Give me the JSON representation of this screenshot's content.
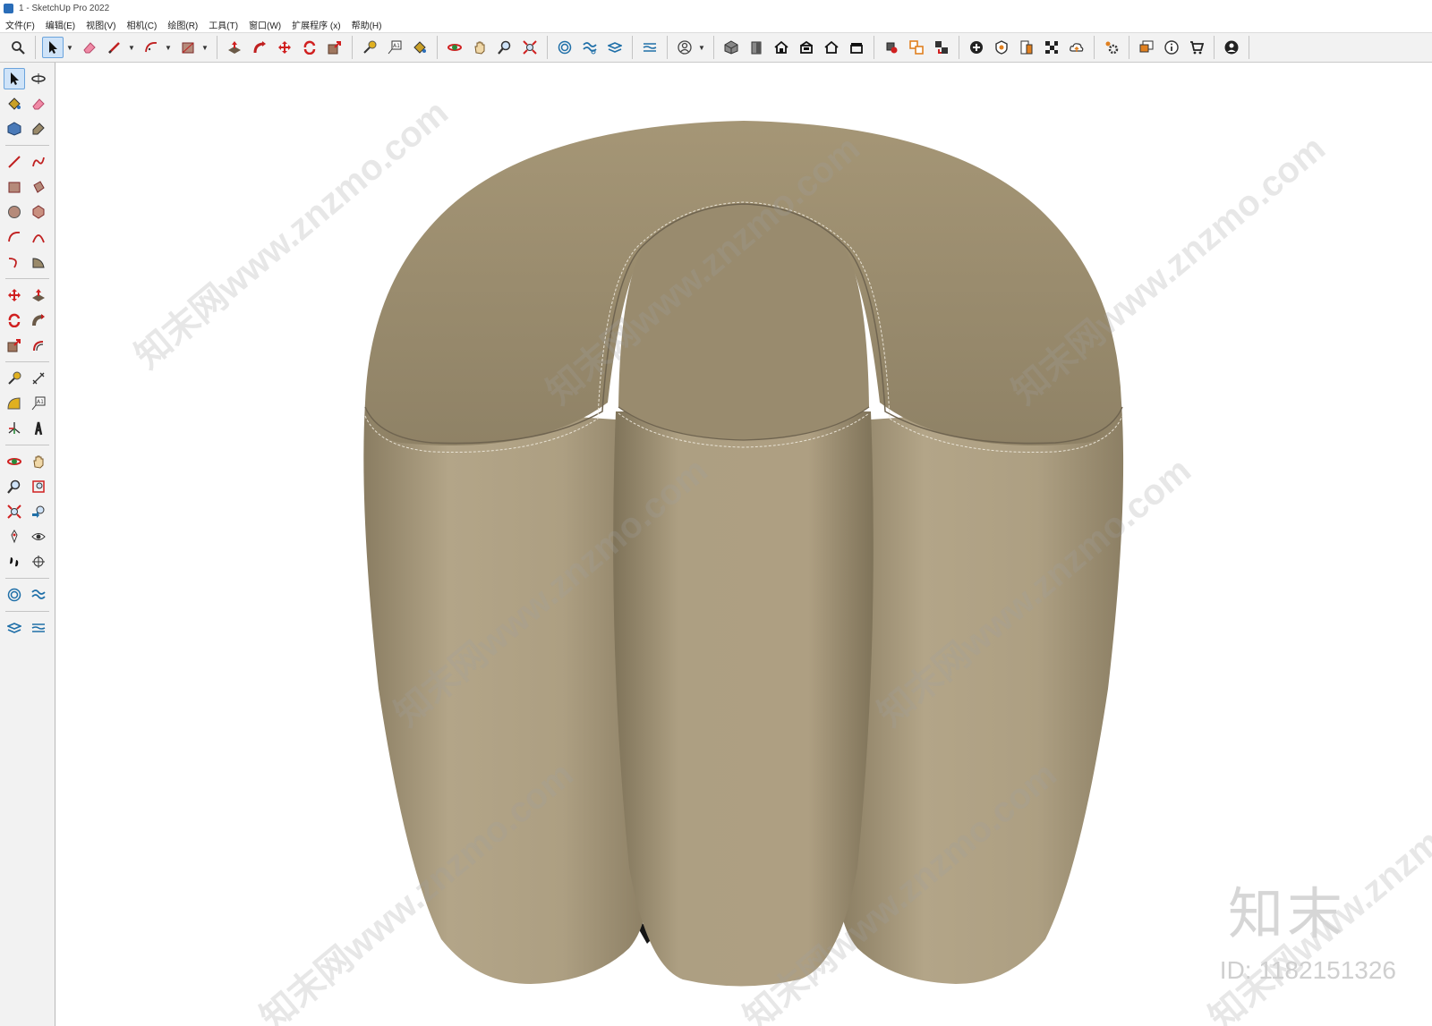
{
  "window": {
    "title": "1 - SketchUp Pro 2022"
  },
  "menu": [
    "文件(F)",
    "编辑(E)",
    "视图(V)",
    "相机(C)",
    "绘图(R)",
    "工具(T)",
    "窗口(W)",
    "扩展程序 (x)",
    "帮助(H)"
  ],
  "toolbar": {
    "groups": [
      [
        "zoom-icon"
      ],
      [
        "select-icon",
        "eraser-icon",
        "pencil-icon",
        "arc-icon",
        "rectangle-icon"
      ],
      [
        "push-pull-icon",
        "follow-me-icon",
        "move-icon",
        "rotate-icon",
        "scale-icon"
      ],
      [
        "tape-measure-icon",
        "text-icon",
        "paint-bucket-icon"
      ],
      [
        "orbit-icon",
        "pan-icon",
        "zoom-magnifier-icon",
        "zoom-extents-icon"
      ],
      [
        "sandbox-icon",
        "smoove-icon",
        "stamp-icon"
      ],
      [
        "flip-edge-icon"
      ],
      [
        "user-profile-icon"
      ],
      [
        "iso-view-icon",
        "front-view-icon",
        "home-view-icon",
        "back-view-icon",
        "left-view-icon",
        "right-view-icon"
      ],
      [
        "component-icon",
        "group-icon",
        "outliner-icon"
      ],
      [
        "add-icon",
        "shield-icon",
        "layers-icon",
        "checker-icon",
        "cloud-icon"
      ],
      [
        "settings-icon"
      ],
      [
        "message-icon",
        "info-icon",
        "cart-icon"
      ],
      [
        "account-icon"
      ]
    ]
  },
  "left_toolbar": [
    [
      "select-icon",
      "orbit-icon"
    ],
    [
      "paint-bucket-icon",
      "eraser-icon"
    ],
    [
      "component-icon",
      "tag-icon"
    ],
    [
      "line-icon",
      "freehand-icon"
    ],
    [
      "rectangle-icon",
      "rotated-rectangle-icon"
    ],
    [
      "circle-icon",
      "polygon-icon"
    ],
    [
      "arc-icon",
      "two-point-arc-icon"
    ],
    [
      "three-point-arc-icon",
      "pie-icon"
    ],
    [
      "move-icon",
      "push-pull-icon"
    ],
    [
      "rotate-icon",
      "follow-me-icon"
    ],
    [
      "scale-icon",
      "offset-icon"
    ],
    [
      "tape-measure-icon",
      "dimension-icon"
    ],
    [
      "protractor-icon",
      "text-icon"
    ],
    [
      "axes-icon",
      "3d-text-icon"
    ],
    [
      "orbit-tool-icon",
      "pan-icon"
    ],
    [
      "zoom-icon",
      "zoom-window-icon"
    ],
    [
      "zoom-extents-icon",
      "previous-view-icon"
    ],
    [
      "position-camera-icon",
      "look-around-icon"
    ],
    [
      "walk-icon",
      "section-plane-icon"
    ],
    [
      "sandbox-from-contours-icon",
      "sandbox-scratch-icon"
    ],
    [
      "smoove-icon",
      "stamp-icon"
    ]
  ],
  "watermark": {
    "text": "知末网www.znzmo.com",
    "logo": "知末",
    "id": "ID: 1182151326"
  },
  "model": {
    "color": "#b1a387",
    "shadow": "#8c7f66",
    "highlight": "#c9bca2",
    "stitch": "#e8e2d4"
  }
}
